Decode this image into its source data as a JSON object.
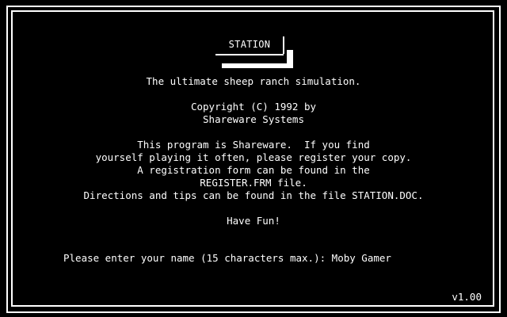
{
  "title": "STATION",
  "tagline": "The ultimate sheep ranch simulation.",
  "copyright": {
    "line1": "Copyright (C) 1992 by",
    "line2": "Shareware Systems"
  },
  "shareware_notice": [
    "This program is Shareware.  If you find",
    "yourself playing it often, please register your copy.",
    "A registration form can be found in the",
    "REGISTER.FRM file.",
    "Directions and tips can be found in the file STATION.DOC."
  ],
  "have_fun": "Have Fun!",
  "name_prompt": {
    "label": "Please enter your name (15 characters max.):",
    "value": "Moby Gamer"
  },
  "version": "v1.00",
  "colors": {
    "background": "#000000",
    "foreground": "#ffffff"
  }
}
